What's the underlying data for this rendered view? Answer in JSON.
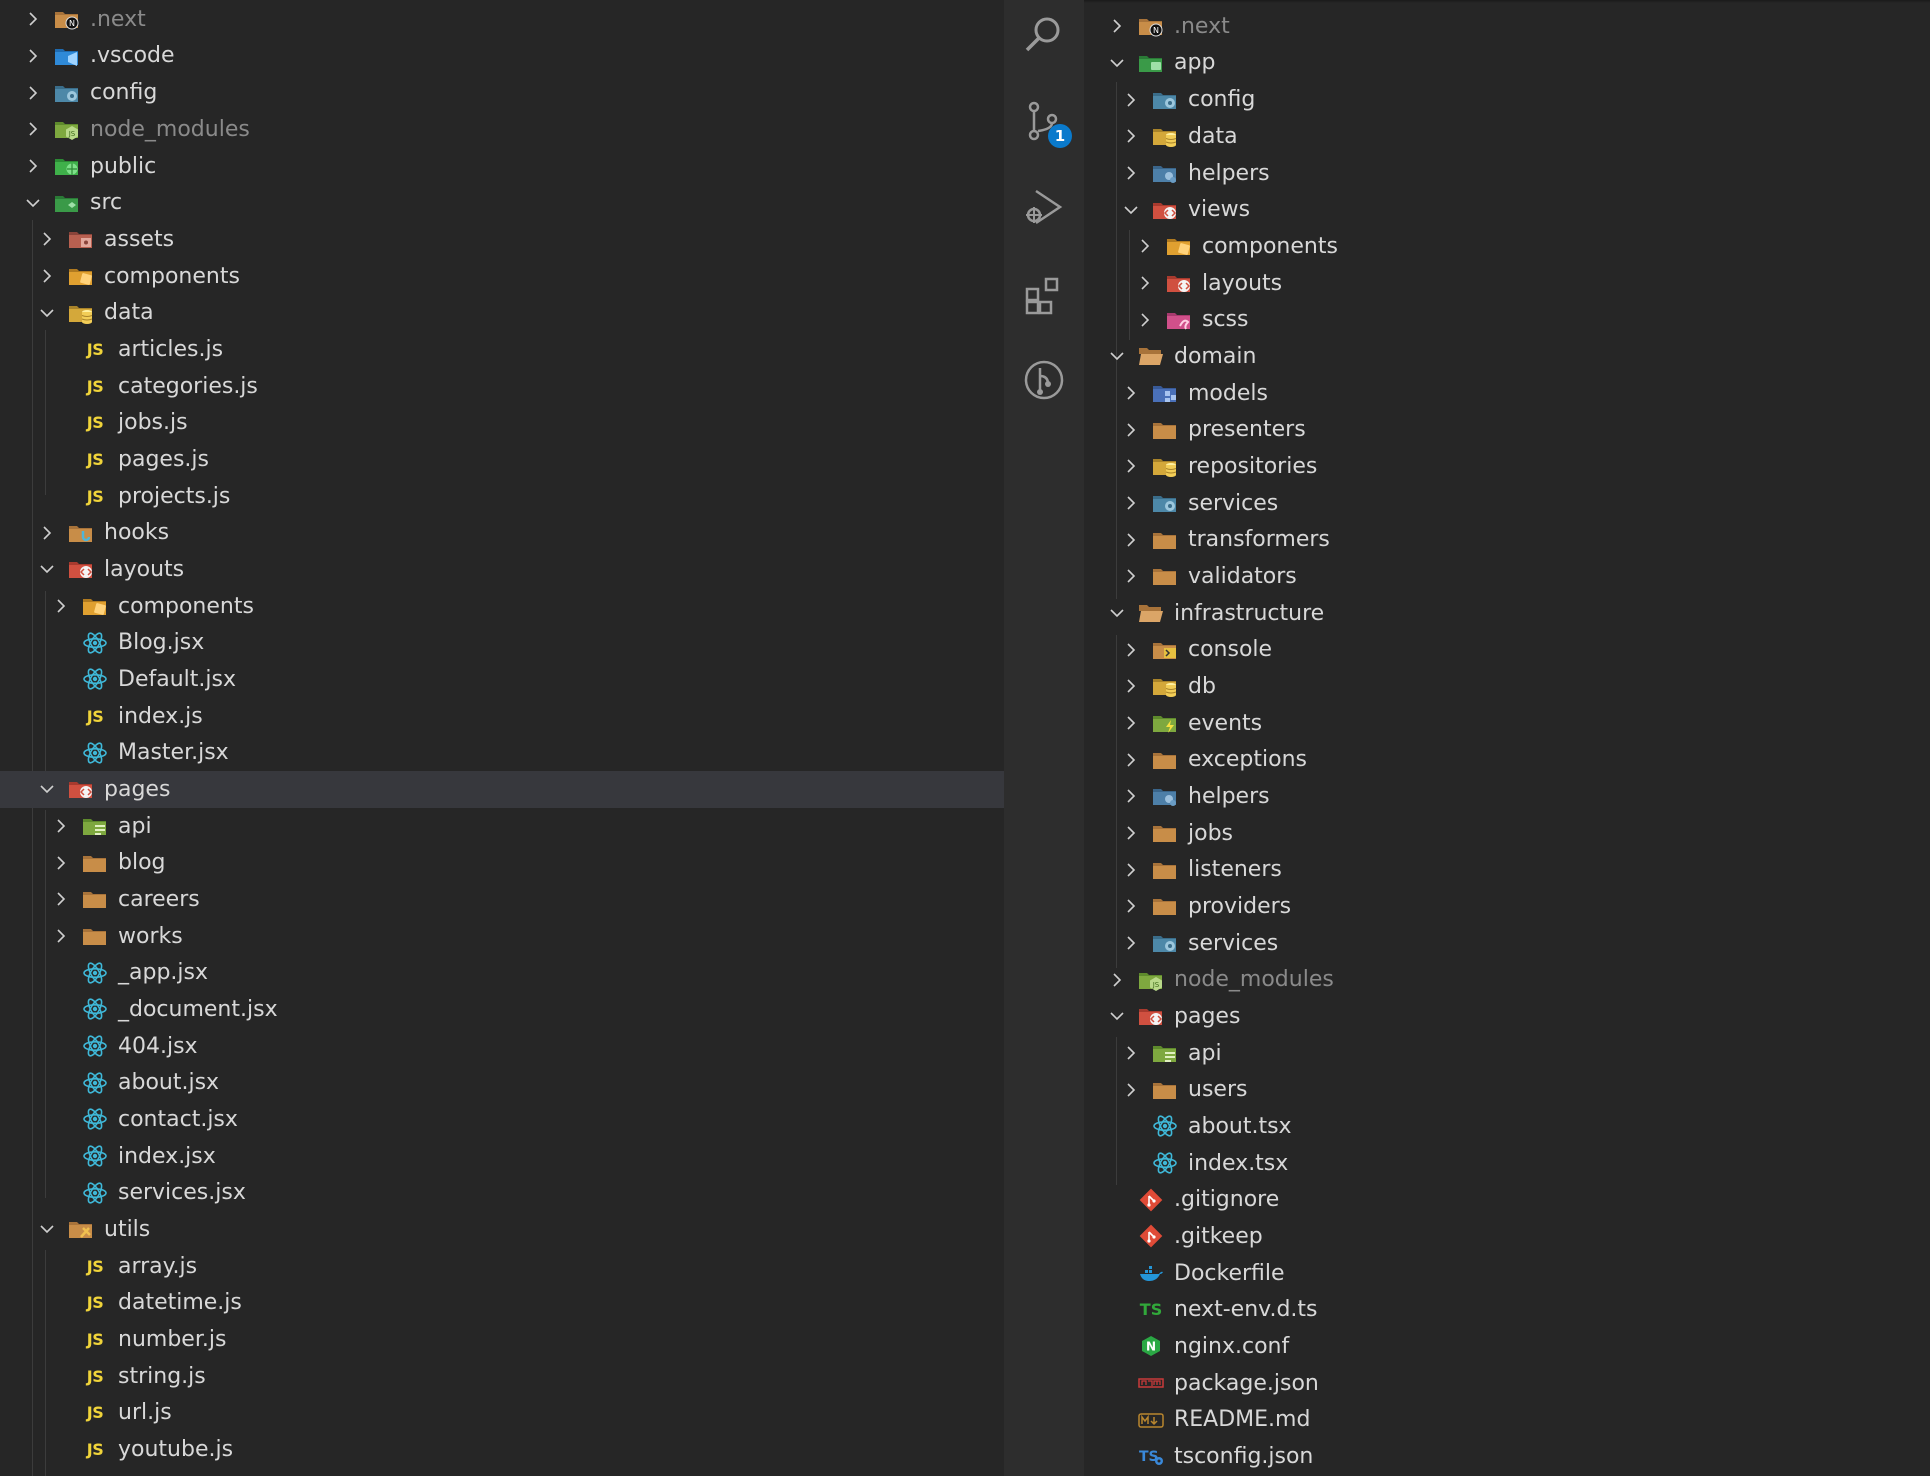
{
  "left_tree": [
    {
      "label": ".next",
      "icon": "folder-next-icon",
      "depth": 0,
      "expand": "closed",
      "dim": true
    },
    {
      "label": ".vscode",
      "icon": "folder-vscode-icon",
      "depth": 0,
      "expand": "closed"
    },
    {
      "label": "config",
      "icon": "folder-config-icon",
      "depth": 0,
      "expand": "closed"
    },
    {
      "label": "node_modules",
      "icon": "folder-node-icon",
      "depth": 0,
      "expand": "closed",
      "dim": true
    },
    {
      "label": "public",
      "icon": "folder-public-icon",
      "depth": 0,
      "expand": "closed"
    },
    {
      "label": "src",
      "icon": "folder-src-icon",
      "depth": 0,
      "expand": "open"
    },
    {
      "label": "assets",
      "icon": "folder-assets-icon",
      "depth": 1,
      "expand": "closed"
    },
    {
      "label": "components",
      "icon": "folder-components-icon",
      "depth": 1,
      "expand": "closed"
    },
    {
      "label": "data",
      "icon": "folder-data-icon",
      "depth": 1,
      "expand": "open"
    },
    {
      "label": "articles.js",
      "icon": "js-file-icon",
      "depth": 2,
      "expand": "none"
    },
    {
      "label": "categories.js",
      "icon": "js-file-icon",
      "depth": 2,
      "expand": "none"
    },
    {
      "label": "jobs.js",
      "icon": "js-file-icon",
      "depth": 2,
      "expand": "none"
    },
    {
      "label": "pages.js",
      "icon": "js-file-icon",
      "depth": 2,
      "expand": "none"
    },
    {
      "label": "projects.js",
      "icon": "js-file-icon",
      "depth": 2,
      "expand": "none"
    },
    {
      "label": "hooks",
      "icon": "folder-hooks-icon",
      "depth": 1,
      "expand": "closed"
    },
    {
      "label": "layouts",
      "icon": "folder-layout-icon",
      "depth": 1,
      "expand": "open"
    },
    {
      "label": "components",
      "icon": "folder-components-icon",
      "depth": 2,
      "expand": "closed"
    },
    {
      "label": "Blog.jsx",
      "icon": "react-file-icon",
      "depth": 2,
      "expand": "none"
    },
    {
      "label": "Default.jsx",
      "icon": "react-file-icon",
      "depth": 2,
      "expand": "none"
    },
    {
      "label": "index.js",
      "icon": "js-file-icon",
      "depth": 2,
      "expand": "none"
    },
    {
      "label": "Master.jsx",
      "icon": "react-file-icon",
      "depth": 2,
      "expand": "none"
    },
    {
      "label": "pages",
      "icon": "folder-views-icon",
      "depth": 1,
      "expand": "open",
      "selected": true
    },
    {
      "label": "api",
      "icon": "folder-api-icon",
      "depth": 2,
      "expand": "closed"
    },
    {
      "label": "blog",
      "icon": "folder-icon",
      "depth": 2,
      "expand": "closed"
    },
    {
      "label": "careers",
      "icon": "folder-icon",
      "depth": 2,
      "expand": "closed"
    },
    {
      "label": "works",
      "icon": "folder-icon",
      "depth": 2,
      "expand": "closed"
    },
    {
      "label": "_app.jsx",
      "icon": "react-file-icon",
      "depth": 2,
      "expand": "none"
    },
    {
      "label": "_document.jsx",
      "icon": "react-file-icon",
      "depth": 2,
      "expand": "none"
    },
    {
      "label": "404.jsx",
      "icon": "react-file-icon",
      "depth": 2,
      "expand": "none"
    },
    {
      "label": "about.jsx",
      "icon": "react-file-icon",
      "depth": 2,
      "expand": "none"
    },
    {
      "label": "contact.jsx",
      "icon": "react-file-icon",
      "depth": 2,
      "expand": "none"
    },
    {
      "label": "index.jsx",
      "icon": "react-file-icon",
      "depth": 2,
      "expand": "none"
    },
    {
      "label": "services.jsx",
      "icon": "react-file-icon",
      "depth": 2,
      "expand": "none"
    },
    {
      "label": "utils",
      "icon": "folder-utils-icon",
      "depth": 1,
      "expand": "open"
    },
    {
      "label": "array.js",
      "icon": "js-file-icon",
      "depth": 2,
      "expand": "none"
    },
    {
      "label": "datetime.js",
      "icon": "js-file-icon",
      "depth": 2,
      "expand": "none"
    },
    {
      "label": "number.js",
      "icon": "js-file-icon",
      "depth": 2,
      "expand": "none"
    },
    {
      "label": "string.js",
      "icon": "js-file-icon",
      "depth": 2,
      "expand": "none"
    },
    {
      "label": "url.js",
      "icon": "js-file-icon",
      "depth": 2,
      "expand": "none"
    },
    {
      "label": "youtube.js",
      "icon": "js-file-icon",
      "depth": 2,
      "expand": "none"
    }
  ],
  "right_tree": [
    {
      "label": ".next",
      "icon": "folder-next-icon",
      "depth": 0,
      "expand": "closed",
      "dim": true
    },
    {
      "label": "app",
      "icon": "folder-app-icon",
      "depth": 0,
      "expand": "open"
    },
    {
      "label": "config",
      "icon": "folder-config-icon",
      "depth": 1,
      "expand": "closed"
    },
    {
      "label": "data",
      "icon": "folder-data-icon",
      "depth": 1,
      "expand": "closed"
    },
    {
      "label": "helpers",
      "icon": "folder-helper-icon",
      "depth": 1,
      "expand": "closed"
    },
    {
      "label": "views",
      "icon": "folder-views-icon",
      "depth": 1,
      "expand": "open"
    },
    {
      "label": "components",
      "icon": "folder-components-icon",
      "depth": 2,
      "expand": "closed"
    },
    {
      "label": "layouts",
      "icon": "folder-layout-icon",
      "depth": 2,
      "expand": "closed"
    },
    {
      "label": "scss",
      "icon": "folder-sass-icon",
      "depth": 2,
      "expand": "closed"
    },
    {
      "label": "domain",
      "icon": "folder-open-icon",
      "depth": 0,
      "expand": "open"
    },
    {
      "label": "models",
      "icon": "folder-models-icon",
      "depth": 1,
      "expand": "closed"
    },
    {
      "label": "presenters",
      "icon": "folder-icon",
      "depth": 1,
      "expand": "closed"
    },
    {
      "label": "repositories",
      "icon": "folder-data-icon",
      "depth": 1,
      "expand": "closed"
    },
    {
      "label": "services",
      "icon": "folder-services-icon",
      "depth": 1,
      "expand": "closed"
    },
    {
      "label": "transformers",
      "icon": "folder-icon",
      "depth": 1,
      "expand": "closed"
    },
    {
      "label": "validators",
      "icon": "folder-icon",
      "depth": 1,
      "expand": "closed"
    },
    {
      "label": "infrastructure",
      "icon": "folder-open-icon",
      "depth": 0,
      "expand": "open"
    },
    {
      "label": "console",
      "icon": "folder-console-icon",
      "depth": 1,
      "expand": "closed"
    },
    {
      "label": "db",
      "icon": "folder-data-icon",
      "depth": 1,
      "expand": "closed"
    },
    {
      "label": "events",
      "icon": "folder-events-icon",
      "depth": 1,
      "expand": "closed"
    },
    {
      "label": "exceptions",
      "icon": "folder-icon",
      "depth": 1,
      "expand": "closed"
    },
    {
      "label": "helpers",
      "icon": "folder-helper-icon",
      "depth": 1,
      "expand": "closed"
    },
    {
      "label": "jobs",
      "icon": "folder-icon",
      "depth": 1,
      "expand": "closed"
    },
    {
      "label": "listeners",
      "icon": "folder-icon",
      "depth": 1,
      "expand": "closed"
    },
    {
      "label": "providers",
      "icon": "folder-icon",
      "depth": 1,
      "expand": "closed"
    },
    {
      "label": "services",
      "icon": "folder-services-icon",
      "depth": 1,
      "expand": "closed"
    },
    {
      "label": "node_modules",
      "icon": "folder-node-icon",
      "depth": 0,
      "expand": "closed",
      "dim": true
    },
    {
      "label": "pages",
      "icon": "folder-views-icon",
      "depth": 0,
      "expand": "open"
    },
    {
      "label": "api",
      "icon": "folder-api-icon",
      "depth": 1,
      "expand": "closed"
    },
    {
      "label": "users",
      "icon": "folder-icon",
      "depth": 1,
      "expand": "closed"
    },
    {
      "label": "about.tsx",
      "icon": "react-file-icon",
      "depth": 1,
      "expand": "none"
    },
    {
      "label": "index.tsx",
      "icon": "react-file-icon",
      "depth": 1,
      "expand": "none"
    },
    {
      "label": ".gitignore",
      "icon": "git-icon",
      "depth": 0,
      "expand": "none"
    },
    {
      "label": ".gitkeep",
      "icon": "git-icon",
      "depth": 0,
      "expand": "none"
    },
    {
      "label": "Dockerfile",
      "icon": "docker-icon",
      "depth": 0,
      "expand": "none"
    },
    {
      "label": "next-env.d.ts",
      "icon": "ts-file-icon",
      "depth": 0,
      "expand": "none"
    },
    {
      "label": "nginx.conf",
      "icon": "nginx-icon",
      "depth": 0,
      "expand": "none"
    },
    {
      "label": "package.json",
      "icon": "npm-icon",
      "depth": 0,
      "expand": "none"
    },
    {
      "label": "README.md",
      "icon": "markdown-icon",
      "depth": 0,
      "expand": "none"
    },
    {
      "label": "tsconfig.json",
      "icon": "tsconfig-icon",
      "depth": 0,
      "expand": "none"
    }
  ],
  "activity_bar": {
    "items": [
      {
        "name": "search-icon"
      },
      {
        "name": "source-control-icon",
        "badge": "1"
      },
      {
        "name": "run-debug-icon"
      },
      {
        "name": "extensions-icon"
      },
      {
        "name": "git-graph-icon"
      }
    ]
  },
  "colors": {
    "background": "#262626",
    "activity_bar": "#2d2d2d",
    "selected_row": "#37383d",
    "text": "#d8d8d8",
    "dim_text": "#8a8a8a",
    "badge": "#0a7acc"
  }
}
